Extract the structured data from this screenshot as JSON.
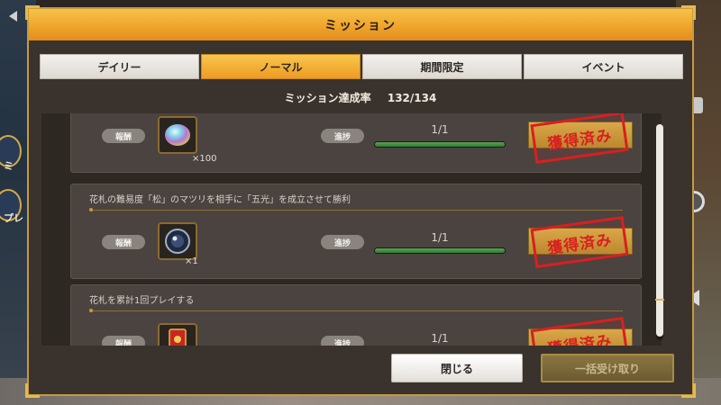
{
  "dialog": {
    "title": "ミッション"
  },
  "tabs": [
    {
      "label": "デイリー",
      "active": false
    },
    {
      "label": "ノーマル",
      "active": true
    },
    {
      "label": "期間限定",
      "active": false
    },
    {
      "label": "イベント",
      "active": false
    }
  ],
  "completion": {
    "label": "ミッション達成率",
    "value": "132/134"
  },
  "missions": [
    {
      "description": "",
      "reward_label": "報酬",
      "reward_icon": "orb-icon",
      "reward_qty": "×100",
      "progress_label": "進捗",
      "progress_text": "1/1",
      "progress_fraction": 1.0,
      "stamp_text": "獲得済み"
    },
    {
      "description": "花札の難易度「松」のマツリを相手に「五光」を成立させて勝利",
      "reward_label": "報酬",
      "reward_icon": "medal-icon",
      "reward_qty": "×1",
      "progress_label": "進捗",
      "progress_text": "1/1",
      "progress_fraction": 1.0,
      "stamp_text": "獲得済み"
    },
    {
      "description": "花札を累計1回プレイする",
      "reward_label": "報酬",
      "reward_icon": "ticket-icon",
      "reward_qty": "",
      "progress_label": "進捗",
      "progress_text": "1/1",
      "progress_fraction": 1.0,
      "stamp_text": "獲得済み"
    }
  ],
  "footer": {
    "close_label": "閉じる",
    "collect_all_label": "一括受け取り"
  },
  "background": {
    "side_text_1": "ミ",
    "side_text_2": "プレ"
  },
  "colors": {
    "accent": "#f0a52b",
    "stamp": "#d8201f",
    "progress": "#3f8d3f"
  }
}
